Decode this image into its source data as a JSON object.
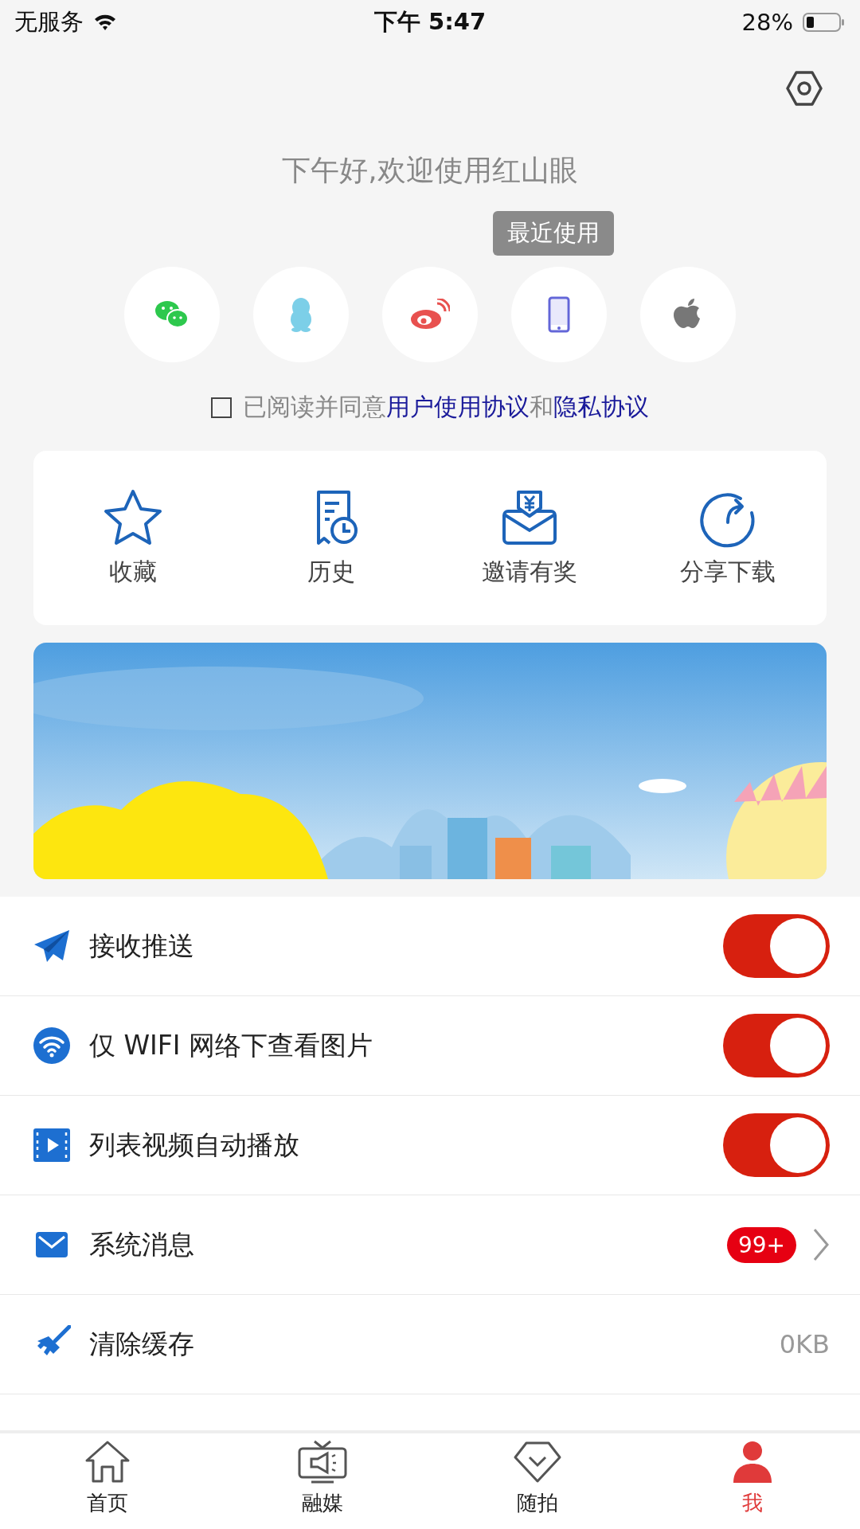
{
  "status_bar": {
    "carrier": "无服务",
    "time": "下午 5:47",
    "battery": "28%"
  },
  "greeting": "下午好,欢迎使用红山眼",
  "recent_tooltip": "最近使用",
  "login_options": [
    {
      "kind": "wechat"
    },
    {
      "kind": "qq"
    },
    {
      "kind": "weibo"
    },
    {
      "kind": "phone"
    },
    {
      "kind": "apple"
    }
  ],
  "agreement": {
    "checked": false,
    "text": "已阅读并同意",
    "link_1": "用户使用协议",
    "and": "和",
    "link_2": "隐私协议"
  },
  "quick_actions": [
    {
      "kind": "star",
      "label": "收藏"
    },
    {
      "kind": "history",
      "label": "历史"
    },
    {
      "kind": "invite",
      "label": "邀请有奖"
    },
    {
      "kind": "share",
      "label": "分享下载"
    }
  ],
  "settings": [
    {
      "kind": "toggle",
      "label": "接收推送",
      "on": true
    },
    {
      "kind": "toggle",
      "label": "仅 WIFI 网络下查看图片",
      "on": true
    },
    {
      "kind": "toggle",
      "label": "列表视频自动播放",
      "on": true
    },
    {
      "kind": "badge",
      "label": "系统消息",
      "badge": "99+"
    },
    {
      "kind": "value",
      "label": "清除缓存",
      "value": "0KB"
    }
  ],
  "tab_bar": [
    {
      "kind": "home",
      "label": "首页",
      "selected": false
    },
    {
      "kind": "tv",
      "label": "融媒",
      "selected": false
    },
    {
      "kind": "diamond",
      "label": "随拍",
      "selected": false
    },
    {
      "kind": "person",
      "label": "我",
      "selected": true
    }
  ]
}
